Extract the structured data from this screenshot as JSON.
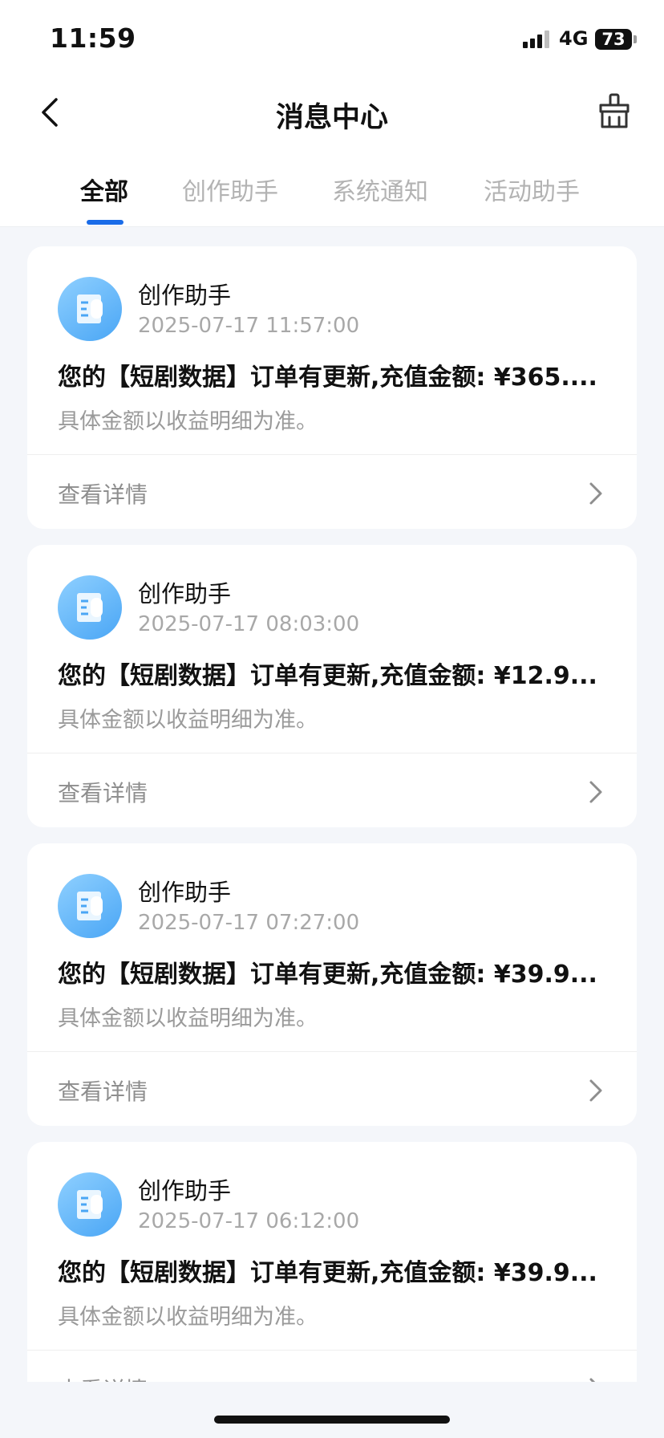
{
  "status_bar": {
    "time": "11:59",
    "network": "4G",
    "battery": "73"
  },
  "header": {
    "title": "消息中心"
  },
  "tabs": [
    {
      "label": "全部",
      "active": true
    },
    {
      "label": "创作助手",
      "active": false
    },
    {
      "label": "系统通知",
      "active": false
    },
    {
      "label": "活动助手",
      "active": false
    }
  ],
  "messages": [
    {
      "sender": "创作助手",
      "time": "2025-07-17 11:57:00",
      "title": "您的【短剧数据】订单有更新,充值金额: ¥365....",
      "subtitle": "具体金额以收益明细为准。",
      "action_label": "查看详情"
    },
    {
      "sender": "创作助手",
      "time": "2025-07-17 08:03:00",
      "title": "您的【短剧数据】订单有更新,充值金额: ¥12.9...",
      "subtitle": "具体金额以收益明细为准。",
      "action_label": "查看详情"
    },
    {
      "sender": "创作助手",
      "time": "2025-07-17 07:27:00",
      "title": "您的【短剧数据】订单有更新,充值金额: ¥39.9...",
      "subtitle": "具体金额以收益明细为准。",
      "action_label": "查看详情"
    },
    {
      "sender": "创作助手",
      "time": "2025-07-17 06:12:00",
      "title": "您的【短剧数据】订单有更新,充值金额: ¥39.9...",
      "subtitle": "具体金额以收益明细为准。",
      "action_label": "查看详情"
    }
  ],
  "icons": {
    "back": "chevron-left-icon",
    "clean": "broom-icon",
    "avatar": "document-icon",
    "chevron": "chevron-right-icon"
  },
  "colors": {
    "accent": "#1a6ce8",
    "background": "#f4f6fa",
    "card": "#ffffff",
    "muted_text": "#a8a8a8"
  }
}
